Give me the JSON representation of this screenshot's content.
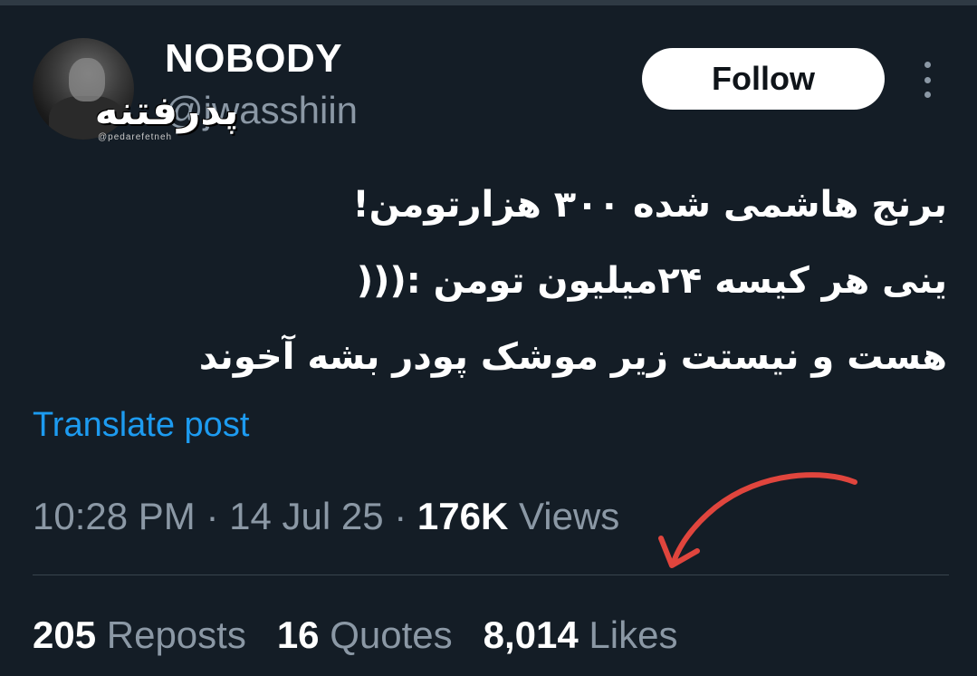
{
  "author": {
    "display_name": "NOBODY",
    "handle": "@jwasshiin"
  },
  "watermark": {
    "logo_text": "پدرفتنه",
    "handle": "@pedarefetneh"
  },
  "follow_button": {
    "label": "Follow"
  },
  "post": {
    "lines": [
      "برنج هاشمی شده ۳۰۰ هزارتومن!",
      "ینی هر کیسه ۲۴میلیون تومن :(((",
      "هست و نیستت زیر موشک پودر بشه آخوند"
    ]
  },
  "translate_link": "Translate post",
  "meta": {
    "time": "10:28 PM",
    "sep1": " · ",
    "date": "14 Jul 25",
    "sep2": " · ",
    "views_count": "176K",
    "views_label": " Views"
  },
  "stats": {
    "reposts": {
      "count": "205",
      "label": "Reposts"
    },
    "quotes": {
      "count": "16",
      "label": "Quotes"
    },
    "likes": {
      "count": "8,014",
      "label": "Likes"
    }
  },
  "colors": {
    "background": "#141d26",
    "link": "#1d9bf0",
    "muted": "#8b98a5",
    "annotation_arrow": "#e0453d"
  }
}
